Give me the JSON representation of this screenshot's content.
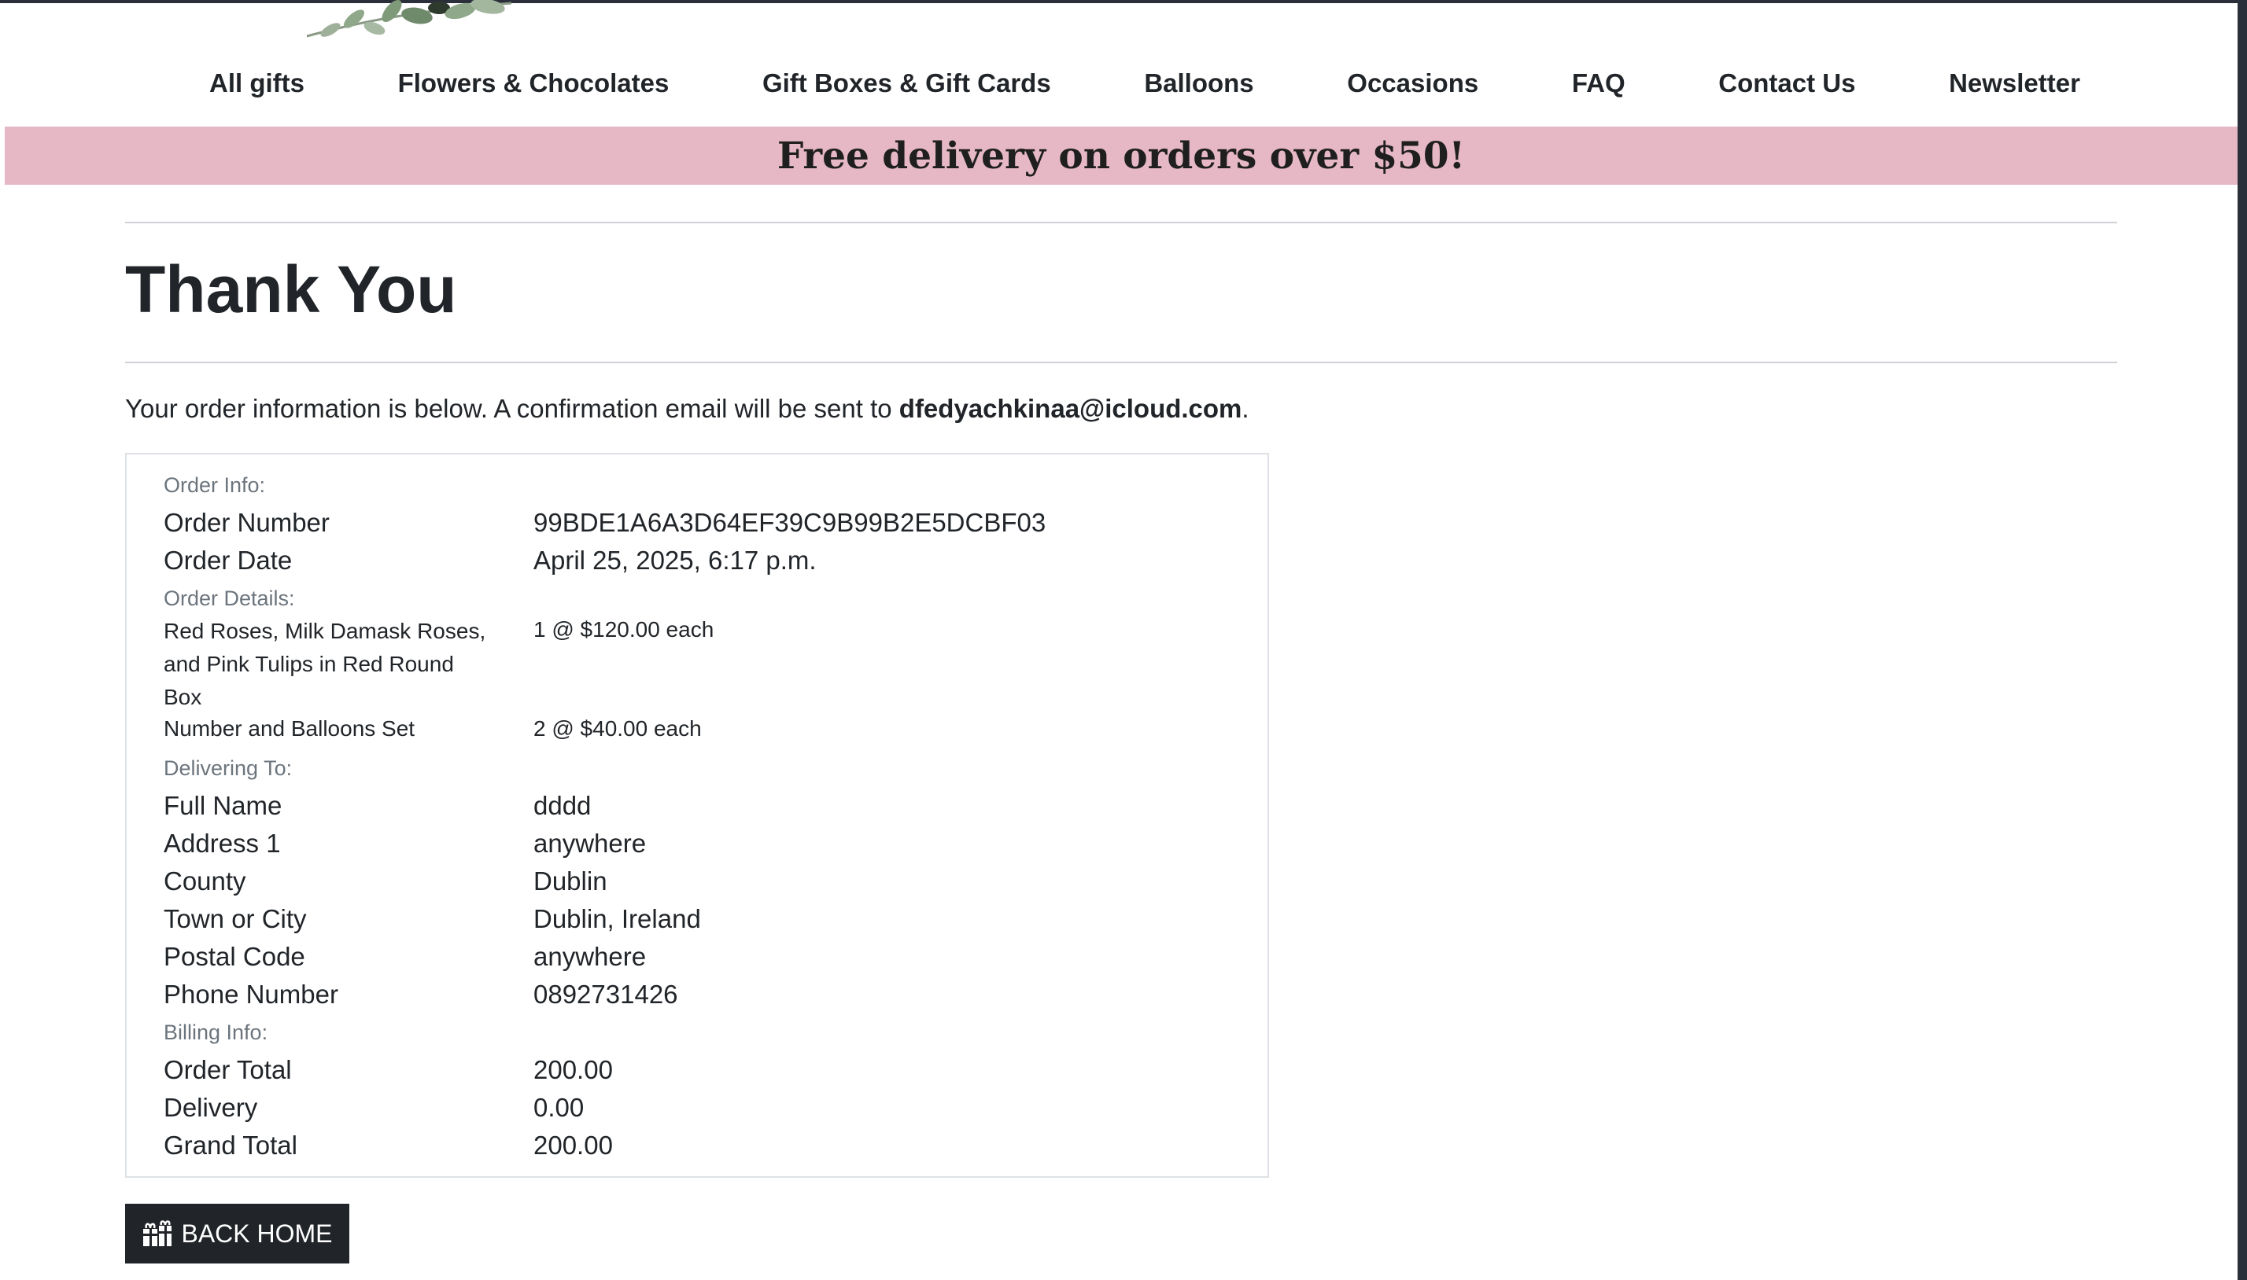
{
  "nav": {
    "items": [
      {
        "label": "All gifts"
      },
      {
        "label": "Flowers & Chocolates"
      },
      {
        "label": "Gift Boxes & Gift Cards"
      },
      {
        "label": "Balloons"
      },
      {
        "label": "Occasions"
      },
      {
        "label": "FAQ"
      },
      {
        "label": "Contact Us"
      },
      {
        "label": "Newsletter"
      }
    ]
  },
  "promo": {
    "text": "Free delivery on orders over $50!",
    "background": "#e6b8c6"
  },
  "page_title": "Thank You",
  "intro": {
    "text": "Your order information is below. A confirmation email will be sent to ",
    "email": "dfedyachkinaa@icloud.com",
    "suffix": "."
  },
  "order_info": {
    "heading": "Order Info:",
    "number_label": "Order Number",
    "number_value": "99BDE1A6A3D64EF39C9B99B2E5DCBF03",
    "date_label": "Order Date",
    "date_value": "April 25, 2025, 6:17 p.m."
  },
  "order_details": {
    "heading": "Order Details:",
    "items": [
      {
        "name": "Red Roses, Milk Damask Roses, and Pink Tulips in Red Round Box",
        "qty": "1 @ $120.00 each"
      },
      {
        "name": "Number and Balloons Set",
        "qty": "2 @ $40.00 each"
      }
    ]
  },
  "delivering_to": {
    "heading": "Delivering To:",
    "fields": [
      {
        "label": "Full Name",
        "value": "dddd"
      },
      {
        "label": "Address 1",
        "value": "anywhere"
      },
      {
        "label": "County",
        "value": "Dublin"
      },
      {
        "label": "Town or City",
        "value": "Dublin, Ireland"
      },
      {
        "label": "Postal Code",
        "value": "anywhere"
      },
      {
        "label": "Phone Number",
        "value": "0892731426"
      }
    ]
  },
  "billing": {
    "heading": "Billing Info:",
    "fields": [
      {
        "label": "Order Total",
        "value": "200.00"
      },
      {
        "label": "Delivery",
        "value": "0.00"
      },
      {
        "label": "Grand Total",
        "value": "200.00"
      }
    ]
  },
  "back_home": {
    "label": "BACK HOME",
    "icon": "gifts-icon"
  }
}
